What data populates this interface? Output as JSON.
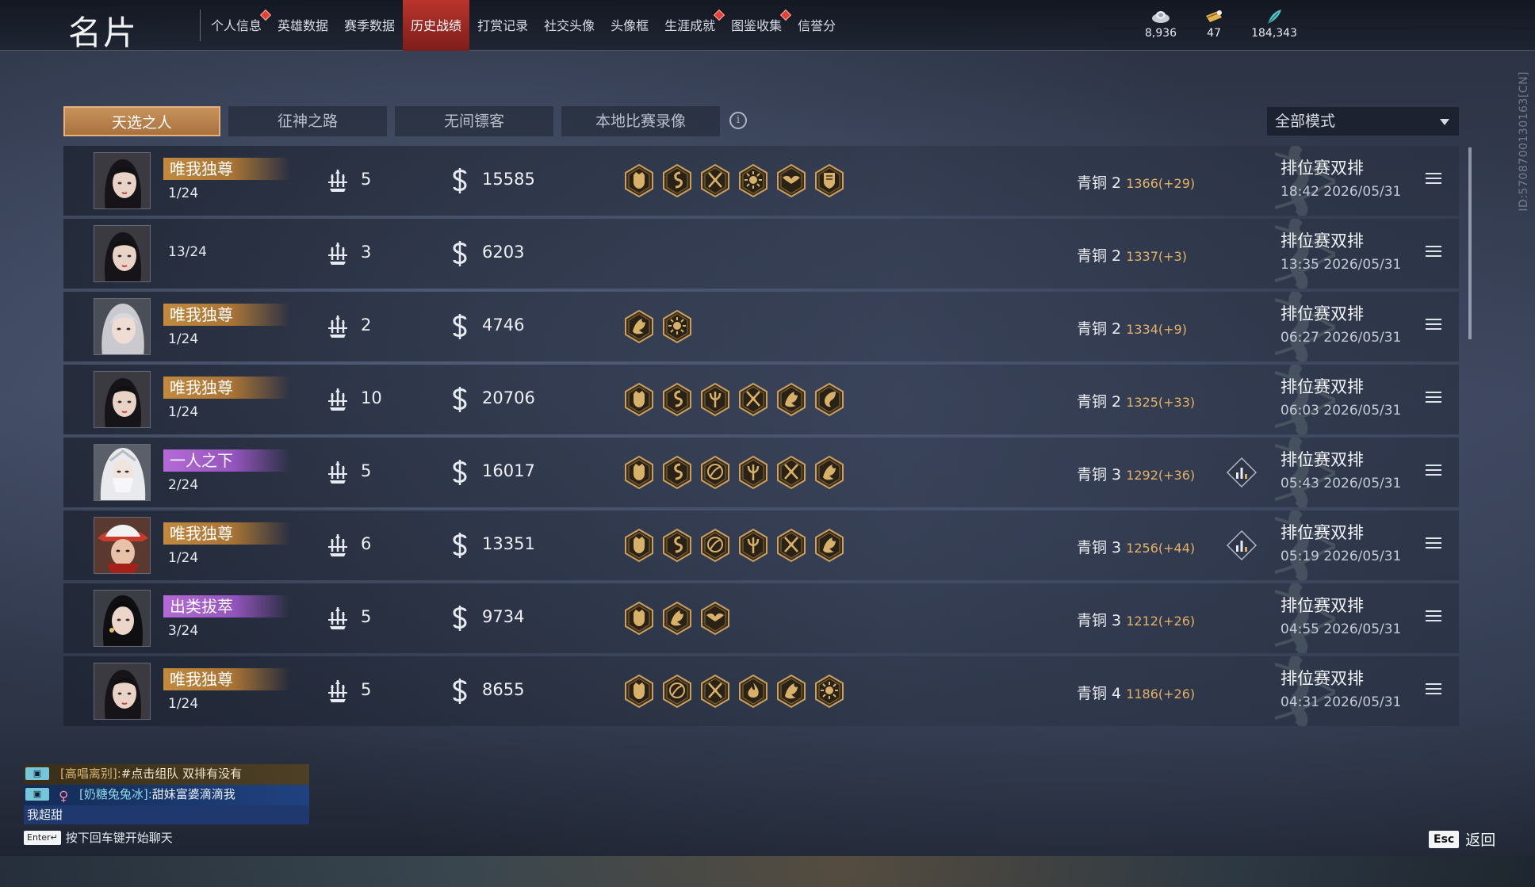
{
  "header": {
    "title": "名片",
    "tabs": [
      {
        "label": "个人信息",
        "dot": true,
        "active": false
      },
      {
        "label": "英雄数据",
        "dot": false,
        "active": false
      },
      {
        "label": "赛季数据",
        "dot": false,
        "active": false
      },
      {
        "label": "历史战绩",
        "dot": false,
        "active": true
      },
      {
        "label": "打赏记录",
        "dot": false,
        "active": false
      },
      {
        "label": "社交头像",
        "dot": false,
        "active": false
      },
      {
        "label": "头像框",
        "dot": false,
        "active": false
      },
      {
        "label": "生涯成就",
        "dot": true,
        "active": false
      },
      {
        "label": "图鉴收集",
        "dot": true,
        "active": false
      },
      {
        "label": "信誉分",
        "dot": false,
        "active": false
      }
    ],
    "currencies": [
      {
        "icon": "gold-ingot-icon",
        "value": "8,936"
      },
      {
        "icon": "ticket-icon",
        "value": "47"
      },
      {
        "icon": "feather-icon",
        "value": "184,343"
      }
    ]
  },
  "side_id": "ID:5708700130163[CN]",
  "subtabs": [
    "天选之人",
    "征神之路",
    "无间镖客",
    "本地比赛录像"
  ],
  "active_subtab": 0,
  "mode_filter": "全部模式",
  "matches": [
    {
      "avatar": "female-dark-hair",
      "title": "唯我独尊",
      "title_color": "gold",
      "place": "1/24",
      "kills": "5",
      "score": "15585",
      "medals": [
        "demon-mask-medal-icon",
        "serpent-medal-icon",
        "crossed-swords-medal-icon",
        "sun-medal-icon",
        "winged-medal-icon",
        "shield-medal-icon"
      ],
      "rank": "青铜 2",
      "points": "1366(+29)",
      "stats_icon": false,
      "mode": "排位赛双排",
      "time": "18:42  2026/05/31"
    },
    {
      "avatar": "female-dark-hair",
      "title": "",
      "title_color": "",
      "place": "13/24",
      "kills": "3",
      "score": "6203",
      "medals": [],
      "rank": "青铜 2",
      "points": "1337(+3)",
      "stats_icon": false,
      "mode": "排位赛双排",
      "time": "13:35  2026/05/31"
    },
    {
      "avatar": "silver-hair",
      "title": "唯我独尊",
      "title_color": "gold",
      "place": "1/24",
      "kills": "2",
      "score": "4746",
      "medals": [
        "dragon-medal-icon",
        "sun-medal-icon"
      ],
      "rank": "青铜 2",
      "points": "1334(+9)",
      "stats_icon": false,
      "mode": "排位赛双排",
      "time": "06:27  2026/05/31"
    },
    {
      "avatar": "female-dark-hair",
      "title": "唯我独尊",
      "title_color": "gold",
      "place": "1/24",
      "kills": "10",
      "score": "20706",
      "medals": [
        "demon-mask-medal-icon",
        "serpent-medal-icon",
        "trident-medal-icon",
        "crossed-swords-medal-icon",
        "dragon-medal-icon",
        "phoenix-medal-icon"
      ],
      "rank": "青铜 2",
      "points": "1325(+33)",
      "stats_icon": false,
      "mode": "排位赛双排",
      "time": "06:03  2026/05/31"
    },
    {
      "avatar": "veiled-white",
      "title": "一人之下",
      "title_color": "purple",
      "place": "2/24",
      "kills": "5",
      "score": "16017",
      "medals": [
        "demon-mask-medal-icon",
        "serpent-medal-icon",
        "swirl-medal-icon",
        "trident-medal-icon",
        "crossed-swords-medal-icon",
        "dragon-medal-icon"
      ],
      "rank": "青铜 3",
      "points": "1292(+36)",
      "stats_icon": true,
      "mode": "排位赛双排",
      "time": "05:43  2026/05/31"
    },
    {
      "avatar": "red-hat",
      "title": "唯我独尊",
      "title_color": "gold",
      "place": "1/24",
      "kills": "6",
      "score": "13351",
      "medals": [
        "demon-mask-medal-icon",
        "serpent-medal-icon",
        "swirl-medal-icon",
        "trident-medal-icon",
        "crossed-swords-medal-icon",
        "dragon-medal-icon"
      ],
      "rank": "青铜 3",
      "points": "1256(+44)",
      "stats_icon": true,
      "mode": "排位赛双排",
      "time": "05:19  2026/05/31"
    },
    {
      "avatar": "black-hair-earring",
      "title": "出类拔萃",
      "title_color": "purple",
      "place": "3/24",
      "kills": "5",
      "score": "9734",
      "medals": [
        "demon-mask-medal-icon",
        "dragon-medal-icon",
        "winged-medal-icon"
      ],
      "rank": "青铜 3",
      "points": "1212(+26)",
      "stats_icon": false,
      "mode": "排位赛双排",
      "time": "04:55  2026/05/31"
    },
    {
      "avatar": "female-dark-hair",
      "title": "唯我独尊",
      "title_color": "gold",
      "place": "1/24",
      "kills": "5",
      "score": "8655",
      "medals": [
        "demon-mask-medal-icon",
        "swirl-medal-icon",
        "crossed-swords-medal-icon",
        "flame-medal-icon",
        "dragon-medal-icon",
        "sun-medal-icon"
      ],
      "rank": "青铜 4",
      "points": "1186(+26)",
      "stats_icon": false,
      "mode": "排位赛双排",
      "time": "04:31  2026/05/31"
    }
  ],
  "chat": {
    "lines": [
      {
        "name": "[高唱离别]:",
        "text": "#点击组队 双排有没有"
      },
      {
        "name": "[奶糖兔兔冰]:",
        "text": "甜妹富婆滴滴我"
      },
      {
        "name": "",
        "text": "我超甜"
      }
    ],
    "enter_key": "Enter↵",
    "hint": "按下回车键开始聊天"
  },
  "footer": {
    "esc_key": "Esc",
    "back_label": "返回"
  },
  "colors": {
    "accent_red": "#b9342c",
    "gold_badge": "#c28a3e",
    "purple_badge": "#b56ad6",
    "points_gold": "#e3b266"
  }
}
